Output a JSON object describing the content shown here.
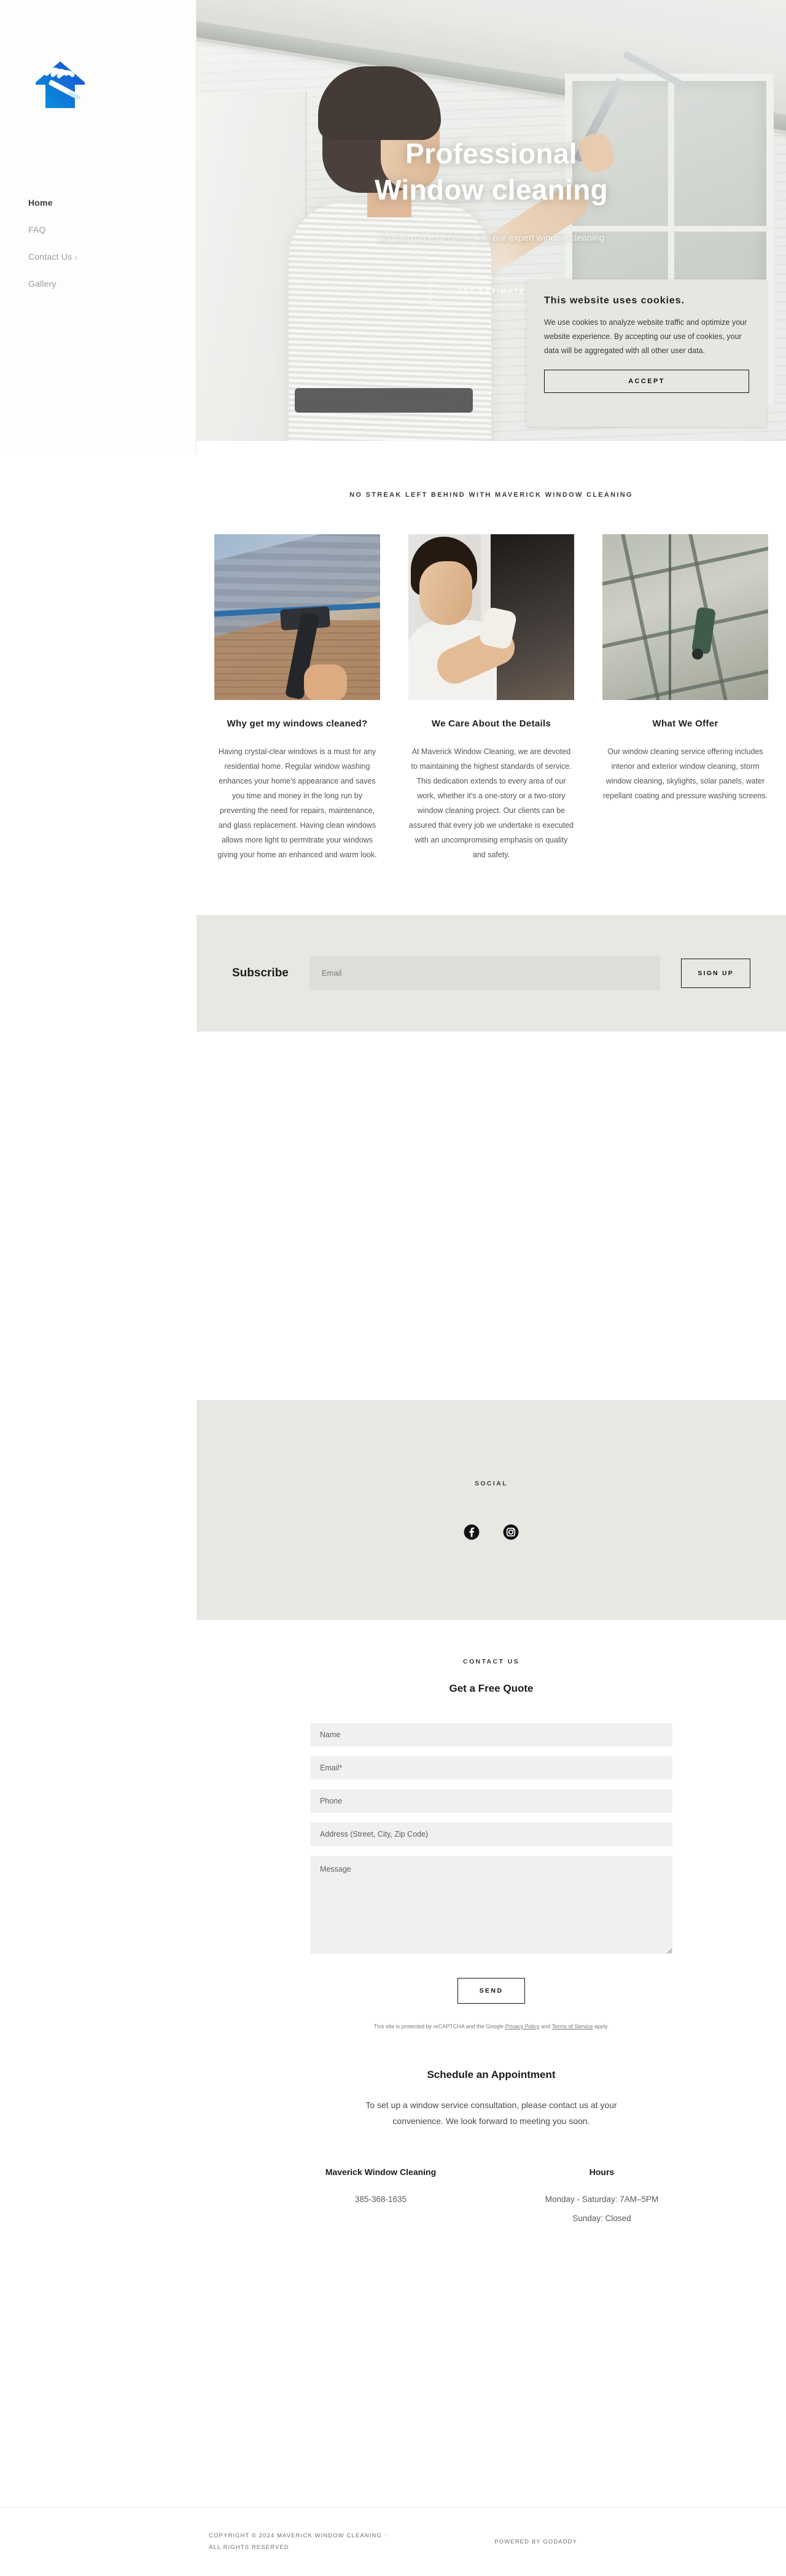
{
  "sidebar": {
    "logo_alt": "Maverick Window Cleaning logo",
    "nav": [
      {
        "label": "Home",
        "active": true,
        "chevron": ""
      },
      {
        "label": "FAQ",
        "active": false,
        "chevron": ""
      },
      {
        "label": "Contact Us",
        "active": false,
        "chevron": "›"
      },
      {
        "label": "Gallery",
        "active": false,
        "chevron": ""
      }
    ]
  },
  "hero": {
    "title_line1": "Professional",
    "title_line2": "Window cleaning",
    "subtitle": "Brighten up your home with our expert window cleaning",
    "cta_label": "GET ESTIMATE"
  },
  "cookies": {
    "title": "This website uses cookies.",
    "body": "We use cookies to analyze website traffic and optimize your website experience. By accepting our use of cookies, your data will be aggregated with all other user data.",
    "accept_label": "ACCEPT"
  },
  "main": {
    "eyebrow": "NO STREAK LEFT BEHIND WITH MAVERICK WINDOW CLEANING",
    "cards": [
      {
        "title": "Why get my windows cleaned?",
        "body": "Having crystal-clear windows is a must for any residential home. Regular window washing enhances your home's appearance and saves you time and money in the long run by preventing the need for repairs, maintenance, and glass replacement. Having clean windows allows more light to permitrate your windows giving your home an enhanced and warm look.",
        "image_alt": "squeegee-cleaning-window"
      },
      {
        "title": "We Care About the Details",
        "body": "At Maverick Window Cleaning, we are devoted to maintaining the highest standards of service. This dedication extends to every area of our work, whether it's a one-story or a two-story window cleaning project. Our clients can be assured that every job we undertake is executed with an uncompromising emphasis on quality and safety.",
        "image_alt": "man-wiping-window-with-cloth"
      },
      {
        "title": "What We Offer",
        "body": "Our window cleaning service offering includes interior and exterior window cleaning, storm window cleaning, skylights, solar panels, water repellant coating and pressure washing screens.",
        "image_alt": "worker-cleaning-high-rise-glass-facade"
      }
    ]
  },
  "subscribe": {
    "label": "Subscribe",
    "placeholder": "Email",
    "value": "",
    "button_label": "SIGN UP"
  },
  "social": {
    "label": "SOCIAL",
    "links": [
      {
        "name": "facebook",
        "title": "Facebook"
      },
      {
        "name": "instagram",
        "title": "Instagram"
      }
    ]
  },
  "contact": {
    "eyebrow": "CONTACT US",
    "title": "Get a Free Quote",
    "fields": [
      {
        "name": "name",
        "placeholder": "Name",
        "value": ""
      },
      {
        "name": "email",
        "placeholder": "Email*",
        "value": ""
      },
      {
        "name": "phone",
        "placeholder": "Phone",
        "value": ""
      },
      {
        "name": "address",
        "placeholder": "Address (Street, City, Zip Code)",
        "value": ""
      }
    ],
    "message_placeholder": "Message",
    "message_value": "",
    "send_label": "SEND",
    "recaptcha_prefix": "This site is protected by reCAPTCHA and the Google ",
    "recaptcha_privacy": "Privacy Policy",
    "recaptcha_and": " and ",
    "recaptcha_terms": "Terms of Service",
    "recaptcha_suffix": " apply."
  },
  "appointment": {
    "title": "Schedule an Appointment",
    "text": "To set up a window service consultation, please contact us at your convenience. We look forward to meeting you soon."
  },
  "info": {
    "business": {
      "title": "Maverick Window Cleaning",
      "phone": "385-368-1635"
    },
    "hours": {
      "title": "Hours",
      "line1": "Monday - Saturday: 7AM–5PM",
      "line2": "Sunday: Closed"
    }
  },
  "footer": {
    "copyright_line1": "COPYRIGHT © 2024 MAVERICK WINDOW CLEANING ·",
    "copyright_line2": "ALL RIGHTS RESERVED",
    "powered_by": "POWERED BY GODADDY"
  },
  "colors": {
    "cookie_bg": "#E7E7E2",
    "band_bg": "#E8E8E3",
    "field_bg": "#F0F0EE",
    "logo_blue": "#0D7FD4",
    "text_dark": "#1B1B1B",
    "text_muted": "#5A5A5A"
  }
}
